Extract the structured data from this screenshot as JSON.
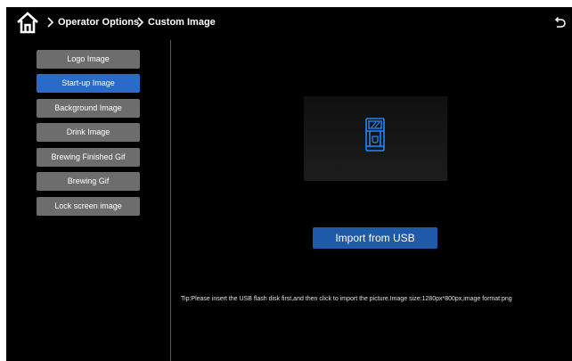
{
  "header": {
    "breadcrumb": [
      "Operator Options",
      "Custom Image"
    ]
  },
  "menu": {
    "items": [
      {
        "label": "Logo Image",
        "active": false
      },
      {
        "label": "Start-up Image",
        "active": true
      },
      {
        "label": "Background Image",
        "active": false
      },
      {
        "label": "Drink Image",
        "active": false
      },
      {
        "label": "Brewing Finished Gif",
        "active": false
      },
      {
        "label": "Brewing Gif",
        "active": false
      },
      {
        "label": "Lock screen image",
        "active": false
      }
    ]
  },
  "main": {
    "preview_icon": "coffee-machine-icon",
    "import_label": "Import from USB",
    "tip": "Tip:Please insert the USB flash disk first,and then click to import the picture.Image size:1280px*800px,image format:png"
  },
  "icons": {
    "home": "home-icon",
    "back": "back-arrow-icon"
  },
  "colors": {
    "active": "#2a6bc9",
    "button": "#6d6d6d",
    "import": "#1f5aa8",
    "accent_icon": "#1e88ff"
  }
}
